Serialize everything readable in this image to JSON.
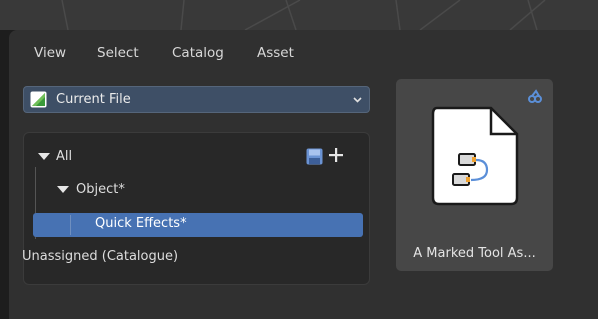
{
  "menu": {
    "items": [
      {
        "label": "View"
      },
      {
        "label": "Select"
      },
      {
        "label": "Catalog"
      },
      {
        "label": "Asset"
      }
    ]
  },
  "library": {
    "selected": "Current File",
    "icon": "current-file-icon"
  },
  "catalog_tree": {
    "root": {
      "label": "All",
      "expanded": true
    },
    "object": {
      "label": "Object*",
      "expanded": true
    },
    "quick_effects": {
      "label": "Quick Effects*",
      "selected": true
    },
    "unassigned": {
      "label": "Unassigned (Catalogue)"
    },
    "actions": {
      "save_icon": "save-catalogs-icon",
      "add_icon": "add-catalog-icon"
    }
  },
  "assets": [
    {
      "label": "A Marked Tool As...",
      "badge_icon": "node-tree-badge-icon",
      "thumbnail_icon": "node-group-icon"
    }
  ],
  "colors": {
    "accent_selected": "#4772b3",
    "library_select_bg": "#3e4f66",
    "badge_blue": "#5b8fd8"
  }
}
